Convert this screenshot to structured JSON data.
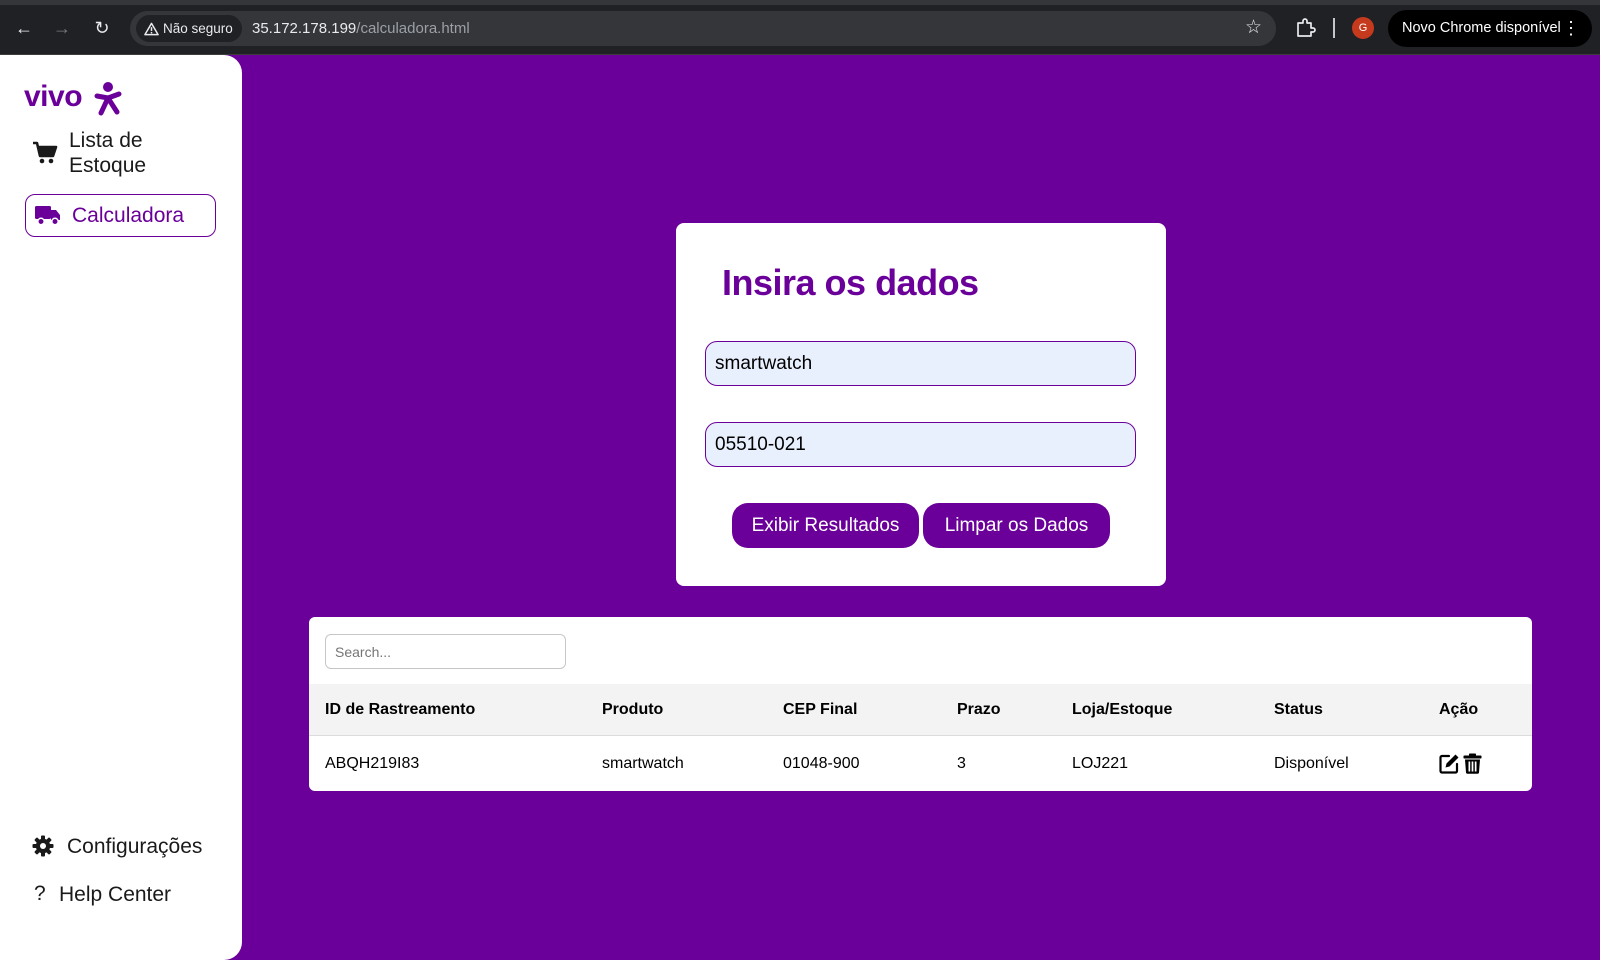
{
  "browser": {
    "security_label": "Não seguro",
    "url_host": "35.172.178.199",
    "url_path": "/calculadora.html",
    "profile_initial": "G",
    "update_label": "Novo Chrome disponível"
  },
  "sidebar": {
    "logo_text": "vivo",
    "items": [
      {
        "label": "Lista de Estoque",
        "icon": "cart-icon"
      },
      {
        "label": "Calculadora",
        "icon": "truck-icon",
        "active": true
      }
    ],
    "bottom_items": [
      {
        "label": "Configurações",
        "icon": "gear-icon"
      },
      {
        "label": "Help Center",
        "icon": "question-icon"
      }
    ]
  },
  "form": {
    "title": "Insira os dados",
    "produto_value": "smartwatch",
    "cep_value": "05510-021",
    "btn_exibir": "Exibir Resultados",
    "btn_limpar": "Limpar os Dados"
  },
  "table": {
    "search_placeholder": "Search...",
    "columns": [
      "ID de Rastreamento",
      "Produto",
      "CEP Final",
      "Prazo",
      "Loja/Estoque",
      "Status",
      "Ação"
    ],
    "rows": [
      {
        "id": "ABQH219I83",
        "produto": "smartwatch",
        "cep": "01048-900",
        "prazo": "3",
        "loja": "LOJ221",
        "status": "Disponível",
        "actions": [
          "edit-icon",
          "trash-icon"
        ]
      }
    ]
  },
  "colors": {
    "brand_purple": "#6a0099",
    "input_bg": "#e8f0fe",
    "chrome_bg": "#202124"
  }
}
